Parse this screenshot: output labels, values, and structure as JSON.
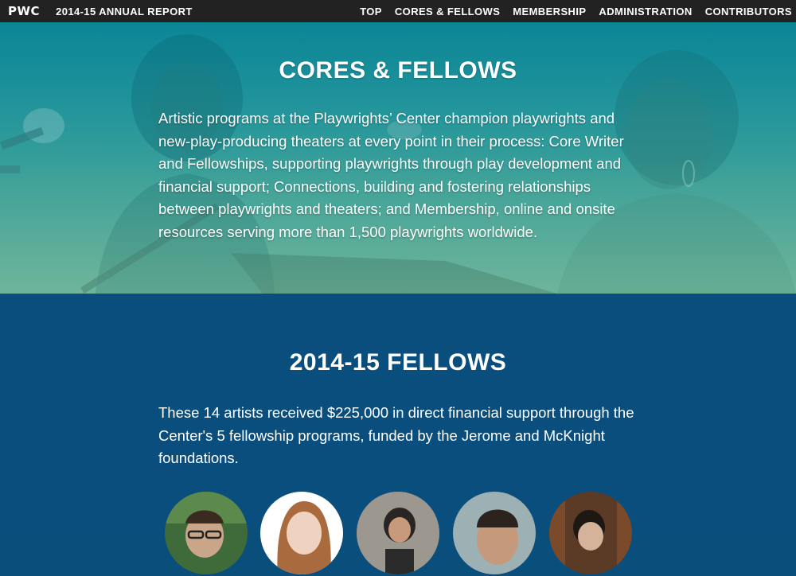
{
  "nav": {
    "logo": "PWC",
    "report_title": "2014-15 ANNUAL REPORT",
    "links": [
      "TOP",
      "CORES & FELLOWS",
      "MEMBERSHIP",
      "ADMINISTRATION",
      "CONTRIBUTORS"
    ]
  },
  "hero": {
    "title": "CORES & FELLOWS",
    "body": "Artistic programs at the Playwrights’ Center champion playwrights and new-play-producing theaters at every point in their process: Core Writer and Fellowships, supporting playwrights through play development and financial support; Connections, building and fostering relationships between playwrights and theaters; and Membership, online and onsite resources serving more than 1,500 playwrights worldwide."
  },
  "fellows": {
    "title": "2014-15 FELLOWS",
    "body": "These 14 artists received $225,000 in direct financial support through the Center's 5 fellowship programs, funded by the Jerome and McKnight foundations."
  },
  "colors": {
    "nav_bg": "#222222",
    "hero_teal": "#1a8a98",
    "fellows_bg": "#0a4e7d"
  }
}
